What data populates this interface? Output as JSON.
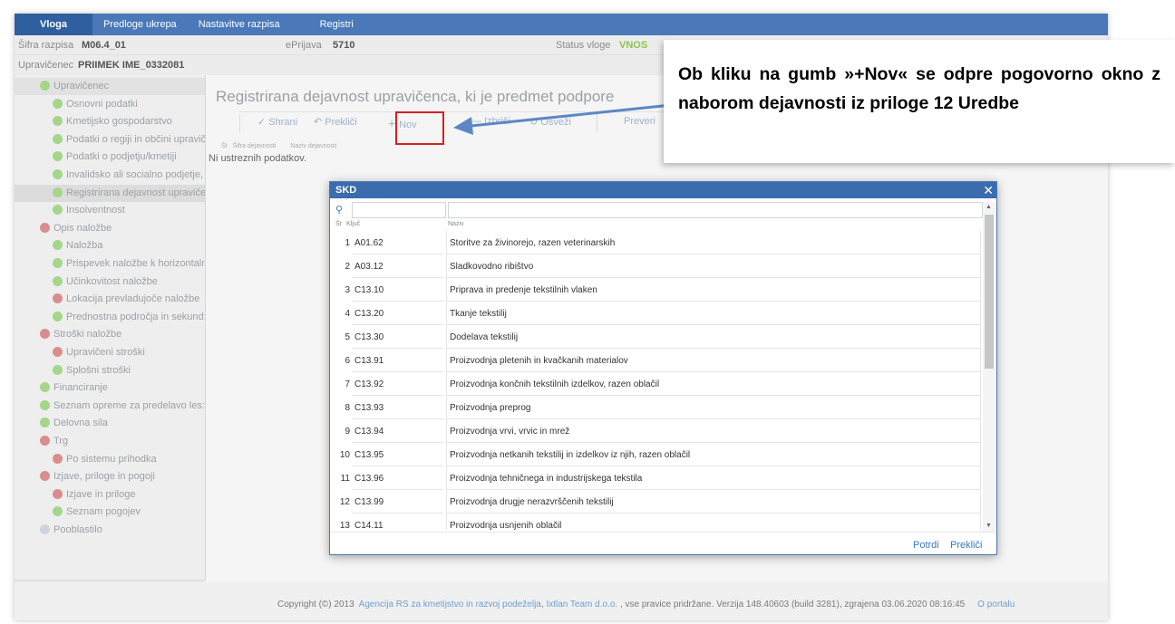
{
  "nav": {
    "tabs": [
      "Vloga",
      "Predloge ukrepa",
      "Nastavitve razpisa",
      "Registri"
    ]
  },
  "header": {
    "sifra_label": "Šifra razpisa",
    "sifra_value": "M06.4_01",
    "eprijava_label": "ePrijava",
    "eprijava_value": "5710",
    "status_label": "Status vloge",
    "status_value": "VNOS",
    "upravicenec_label": "Upravičenec",
    "upravicenec_value": "PRIIMEK IME_0332081"
  },
  "sidebar": {
    "items": [
      {
        "label": "Upravičenec",
        "status": "green"
      },
      {
        "label": "Osnovni podatki",
        "status": "green"
      },
      {
        "label": "Kmetijsko gospodarstvo",
        "status": "green"
      },
      {
        "label": "Podatki o regiji in občini upravič",
        "status": "green"
      },
      {
        "label": "Podatki o podjetju/kmetiji",
        "status": "green"
      },
      {
        "label": "Invalidsko ali socialno podjetje,",
        "status": "green"
      },
      {
        "label": "Registrirana dejavnost upravičei",
        "status": "green"
      },
      {
        "label": "Insolventnost",
        "status": "green"
      },
      {
        "label": "Opis naložbe",
        "status": "red"
      },
      {
        "label": "Naložba",
        "status": "green"
      },
      {
        "label": "Prispevek naložbe k horizontaln",
        "status": "green"
      },
      {
        "label": "Učinkovitost naložbe",
        "status": "green"
      },
      {
        "label": "Lokacija prevladujoče naložbe",
        "status": "red"
      },
      {
        "label": "Prednostna področja in sekund:",
        "status": "green"
      },
      {
        "label": "Stroški naložbe",
        "status": "red"
      },
      {
        "label": "Upravičeni stroški",
        "status": "red"
      },
      {
        "label": "Splošni stroški",
        "status": "green"
      },
      {
        "label": "Financiranje",
        "status": "green"
      },
      {
        "label": "Seznam opreme za predelavo les:",
        "status": "green"
      },
      {
        "label": "Delovna sila",
        "status": "green"
      },
      {
        "label": "Trg",
        "status": "red"
      },
      {
        "label": "Po sistemu prihodka",
        "status": "red"
      },
      {
        "label": "Izjave, priloge in pogoji",
        "status": "red"
      },
      {
        "label": "Izjave in priloge",
        "status": "red"
      },
      {
        "label": "Seznam pogojev",
        "status": "green"
      },
      {
        "label": "Pooblastilo",
        "status": "gray"
      }
    ]
  },
  "main": {
    "title": "Registrirana dejavnost upravičenca, ki je predmet podpore",
    "toolbar": {
      "save": "Shrani",
      "cancel": "Prekliči",
      "new": "Nov",
      "delete": "Izbriši",
      "refresh": "Osveži",
      "check": "Preveri"
    },
    "col_num": "Št",
    "col_code": "Šifra dejavnosti",
    "col_name": "Naziv dejavnosti",
    "empty": "Ni ustreznih podatkov."
  },
  "callout": {
    "text": "Ob kliku na gumb »+Nov« se odpre pogovorno okno z naborom dejavnosti iz priloge 12 Uredbe"
  },
  "dialog": {
    "title": "SKD",
    "col_num": "Št",
    "col_key": "Ključ",
    "col_name": "Naziv",
    "rows": [
      {
        "num": "1",
        "key": "A01.62",
        "name": "Storitve za živinorejo, razen veterinarskih"
      },
      {
        "num": "2",
        "key": "A03.12",
        "name": "Sladkovodno ribištvo"
      },
      {
        "num": "3",
        "key": "C13.10",
        "name": "Priprava in predenje tekstilnih vlaken"
      },
      {
        "num": "4",
        "key": "C13.20",
        "name": "Tkanje tekstilij"
      },
      {
        "num": "5",
        "key": "C13.30",
        "name": "Dodelava tekstilij"
      },
      {
        "num": "6",
        "key": "C13.91",
        "name": "Proizvodnja pletenih in kvačkanih materialov"
      },
      {
        "num": "7",
        "key": "C13.92",
        "name": "Proizvodnja končnih tekstilnih izdelkov, razen oblačil"
      },
      {
        "num": "8",
        "key": "C13.93",
        "name": "Proizvodnja preprog"
      },
      {
        "num": "9",
        "key": "C13.94",
        "name": "Proizvodnja vrvi, vrvic in mrež"
      },
      {
        "num": "10",
        "key": "C13.95",
        "name": "Proizvodnja netkanih tekstilij in izdelkov iz njih, razen oblačil"
      },
      {
        "num": "11",
        "key": "C13.96",
        "name": "Proizvodnja tehničnega in industrijskega tekstila"
      },
      {
        "num": "12",
        "key": "C13.99",
        "name": "Proizvodnja drugje nerazvrščenih tekstilij"
      },
      {
        "num": "13",
        "key": "C14.11",
        "name": "Proizvodnja usnjenih oblačil"
      }
    ],
    "confirm": "Potrdi",
    "cancel": "Prekliči"
  },
  "footer": {
    "prefix": "Copyright (©) 2013",
    "agency": "Agencija RS za kmetijstvo in razvoj podeželja",
    "company": "Ixtlan Team d.o.o.",
    "suffix": ", vse pravice pridržane. Verzija 148.40603 (build 3281), zgrajena 03.06.2020 08:16:45",
    "portal": "O portalu"
  },
  "colors": {
    "nav_bg": "#4a78b8",
    "status_green": "#8bc34a",
    "dot_green": "#a5d68a",
    "dot_red": "#d98e8e",
    "dot_gray": "#cdd4dc",
    "highlight": "#d62020"
  }
}
